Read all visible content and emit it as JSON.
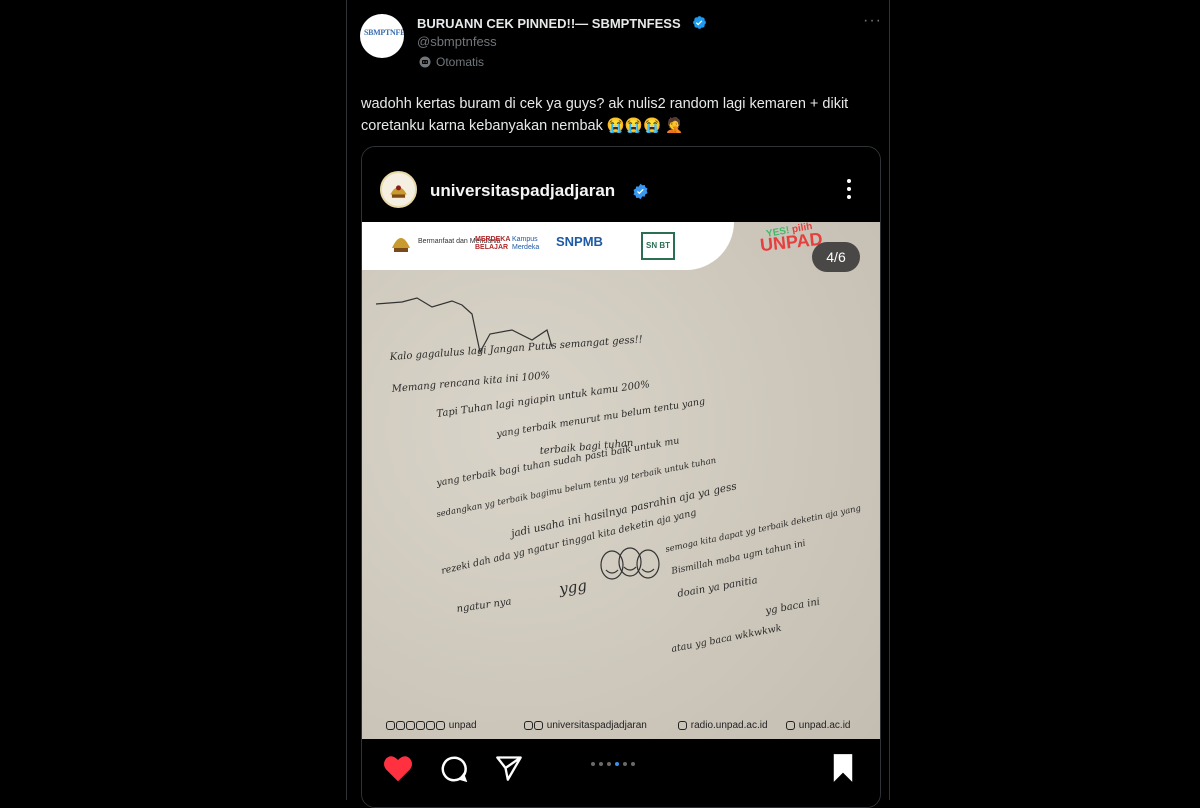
{
  "account": {
    "display_name": "BURUANN CEK PINNED!!— SBMPTNFESS",
    "handle": "@sbmptnfess",
    "automated_label": "Otomatis",
    "avatar_text": "SBMPTNFESS"
  },
  "tweet": {
    "text": "wadohh kertas buram di cek ya guys? ak nulis2 random lagi kemaren + dikit coretanku karna kebanyakan nembak 😭😭😭 🤦"
  },
  "embedded_post": {
    "username": "universitaspadjadjaran",
    "slide_counter": "4/6",
    "brand_logos": {
      "bermanfaat": "Bermanfaat dan Mendunia",
      "merdeka": "MERDEKA BELAJAR",
      "kampus": "Kampus Merdeka",
      "snpmb": "SNPMB",
      "snbt": "SN BT",
      "yes": "YES!",
      "pilih": "pilih",
      "unpad": "UNPAD"
    },
    "handwriting": [
      "Kalo gagalulus lagi Jangan Putus semangat gess!!",
      "Memang rencana kita ini 100%",
      "Tapi Tuhan lagi ngiapin untuk kamu 200%",
      "yang terbaik menurut mu belum tentu yang",
      "terbaik bagi tuhan",
      "yang terbaik bagi tuhan sudah pasti baik untuk mu",
      "sedangkan yg terbaik bagimu belum tentu yg terbaik untuk tuhan",
      "jadi usaha ini hasilnya pasrahin aja ya gess",
      "rezeki dah ada yg ngatur tinggal kita deketin aja yang",
      "ngatur nya",
      "ygg",
      "semoga kita dapat yg terbaik deketin aja yang",
      "Bismillah maba ugm tahun ini",
      "doain ya panitia",
      "yg baca ini",
      "atau yg baca wkkwkwk"
    ],
    "socials": {
      "unpad": "unpad",
      "ig": "universitaspadjadjaran",
      "radio": "radio.unpad.ac.id",
      "web": "unpad.ac.id"
    }
  }
}
